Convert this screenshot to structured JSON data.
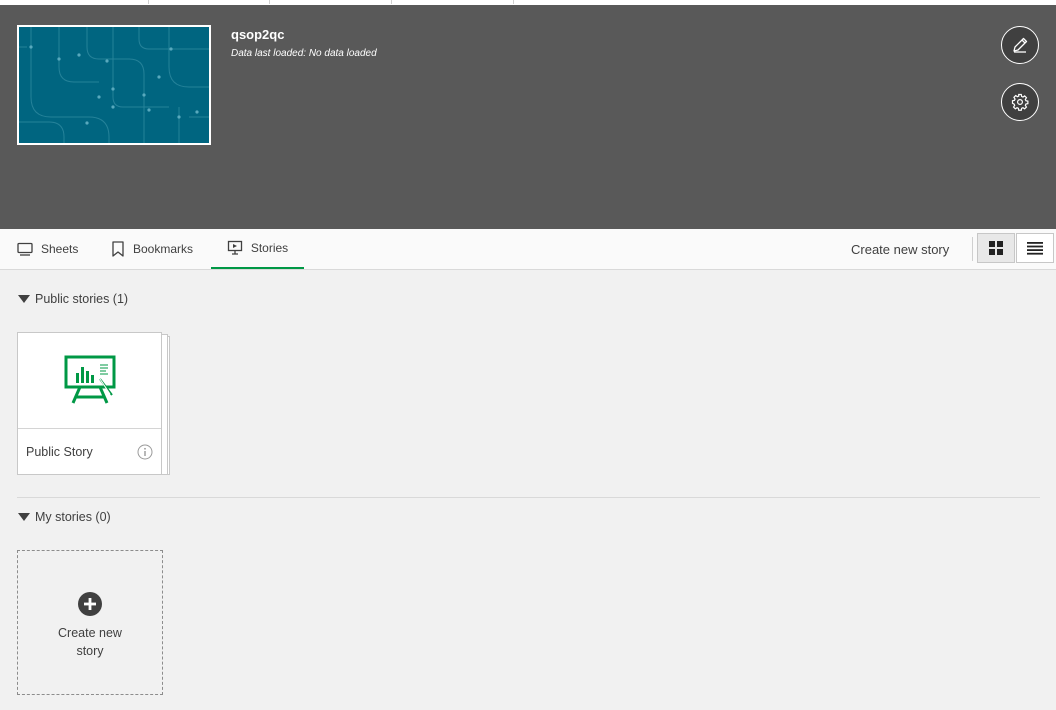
{
  "app": {
    "title": "qsop2qc",
    "subtitle": "Data last loaded: No data loaded"
  },
  "tabs": [
    {
      "label": "Sheets",
      "icon": "sheet-icon",
      "active": false
    },
    {
      "label": "Bookmarks",
      "icon": "bookmark-icon",
      "active": false
    },
    {
      "label": "Stories",
      "icon": "story-icon",
      "active": true
    }
  ],
  "toolbar": {
    "create_story_label": "Create new story",
    "views": [
      {
        "name": "grid-view",
        "icon": "grid-icon",
        "selected": true
      },
      {
        "name": "list-view",
        "icon": "list-icon",
        "selected": false
      }
    ]
  },
  "public_section": {
    "label": "Public stories (1)",
    "stories": [
      {
        "title": "Public Story",
        "icon": "presentation-board-icon"
      }
    ]
  },
  "my_section": {
    "label": "My stories (0)",
    "create_label": "Create new story"
  },
  "colors": {
    "header_bg": "#595959",
    "accent": "#009845",
    "thumbnail_bg": "#006580"
  }
}
